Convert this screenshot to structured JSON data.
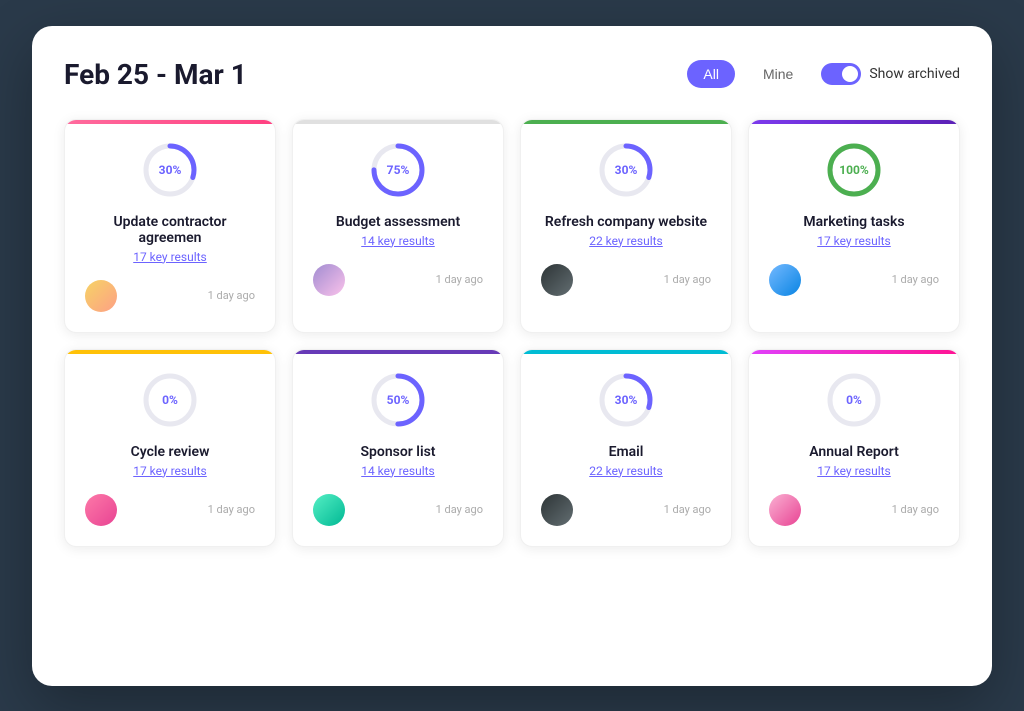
{
  "header": {
    "date_range": "Feb 25 - Mar 1",
    "filter_all_label": "All",
    "filter_mine_label": "Mine",
    "toggle_label": "Show archived",
    "active_filter": "All"
  },
  "cards": [
    {
      "id": "card-1",
      "border_class": "border-pink",
      "progress": 30,
      "progress_color": "#6c63ff",
      "title": "Update contractor agreemen",
      "key_results": "17 key results",
      "time": "1 day ago",
      "avatar_class": "av1",
      "avatar_emoji": "👤"
    },
    {
      "id": "card-2",
      "border_class": "border-gray",
      "progress": 75,
      "progress_color": "#6c63ff",
      "title": "Budget assessment",
      "key_results": "14 key results",
      "time": "1 day ago",
      "avatar_class": "av2",
      "avatar_emoji": "👤"
    },
    {
      "id": "card-3",
      "border_class": "border-green",
      "progress": 30,
      "progress_color": "#6c63ff",
      "title": "Refresh company website",
      "key_results": "22 key results",
      "time": "1 day ago",
      "avatar_class": "av3",
      "avatar_emoji": "👤"
    },
    {
      "id": "card-4",
      "border_class": "border-purple",
      "progress": 100,
      "progress_color": "#4caf50",
      "title": "Marketing tasks",
      "key_results": "17 key results",
      "time": "1 day ago",
      "avatar_class": "av4",
      "avatar_emoji": "👤"
    },
    {
      "id": "card-5",
      "border_class": "border-yellow",
      "progress": 0,
      "progress_color": "#6c63ff",
      "title": "Cycle review",
      "key_results": "17 key results",
      "time": "1 day ago",
      "avatar_class": "av5",
      "avatar_emoji": "👤"
    },
    {
      "id": "card-6",
      "border_class": "border-deep-purple",
      "progress": 50,
      "progress_color": "#6c63ff",
      "title": "Sponsor list",
      "key_results": "14 key results",
      "time": "1 day ago",
      "avatar_class": "av6",
      "avatar_emoji": "👤"
    },
    {
      "id": "card-7",
      "border_class": "border-cyan",
      "progress": 30,
      "progress_color": "#6c63ff",
      "title": "Email",
      "key_results": "22 key results",
      "time": "1 day ago",
      "avatar_class": "av7",
      "avatar_emoji": "👤"
    },
    {
      "id": "card-8",
      "border_class": "border-magenta",
      "progress": 0,
      "progress_color": "#6c63ff",
      "title": "Annual Report",
      "key_results": "17 key results",
      "time": "1 day ago",
      "avatar_class": "av8",
      "avatar_emoji": "👤"
    }
  ]
}
